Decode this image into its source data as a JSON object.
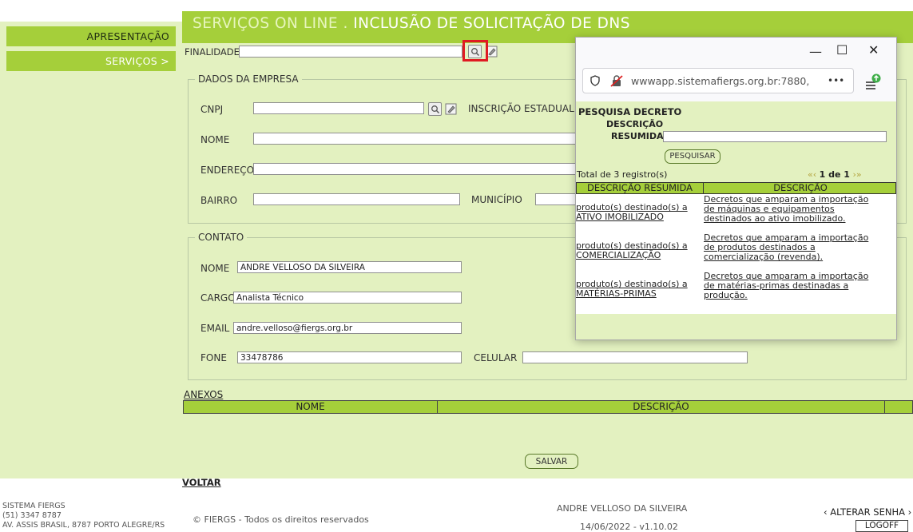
{
  "sidebar": {
    "items": [
      {
        "label": "APRESENTAÇÃO"
      },
      {
        "label": "SERVIÇOS >"
      }
    ]
  },
  "page": {
    "title_prefix": "SERVIÇOS ON LINE . ",
    "title": "INCLUSÃO DE SOLICITAÇÃO DE DNS"
  },
  "form": {
    "finalidade_label": "FINALIDADE",
    "finalidade_value": "",
    "empresa": {
      "legend": "DADOS DA EMPRESA",
      "cnpj_label": "CNPJ",
      "cnpj_value": "",
      "inscricao_label": "INSCRIÇÃO ESTADUAL",
      "nome_label": "NOME",
      "nome_value": "",
      "endereco_label": "ENDEREÇO",
      "endereco_value": "",
      "bairro_label": "BAIRRO",
      "bairro_value": "",
      "municipio_label": "MUNICÍPIO",
      "municipio_value": ""
    },
    "contato": {
      "legend": "CONTATO",
      "nome_label": "NOME",
      "nome_value": "ANDRE VELLOSO DA SILVEIRA",
      "cargo_label": "CARGO",
      "cargo_value": "Analista Técnico",
      "email_label": "EMAIL",
      "email_value": "andre.velloso@fiergs.org.br",
      "fone_label": "FONE",
      "fone_value": "33478786",
      "celular_label": "CELULAR",
      "celular_value": ""
    }
  },
  "anexos": {
    "label": "ANEXOS",
    "columns": [
      "NOME",
      "DESCRIÇÃO"
    ]
  },
  "buttons": {
    "salvar": "SALVAR",
    "voltar": "VOLTAR"
  },
  "footer": {
    "org": "SISTEMA FIERGS",
    "phone": "(51) 3347 8787",
    "address": "AV. ASSIS BRASIL, 8787 PORTO ALEGRE/RS",
    "copyright": "© FIERGS - Todos os direitos reservados",
    "user": "ANDRE VELLOSO DA SILVEIRA",
    "version": "14/06/2022 - v1.10.02",
    "alterar_senha": "‹ ALTERAR SENHA ›",
    "logoff": "LOGOFF"
  },
  "popup": {
    "url": "wwwapp.sistemafiergs.org.br:7880,",
    "url_more": "•••",
    "heading": "PESQUISA DECRETO",
    "search_label_1": "DESCRIÇÃO",
    "search_label_2": "RESUMIDA",
    "search_value": "",
    "search_button": "PESQUISAR",
    "total": "Total de 3 registro(s)",
    "pagination": "1 de 1",
    "columns": [
      "DESCRIÇÃO RESUMIDA",
      "DESCRIÇÃO"
    ],
    "rows": [
      {
        "resumida_1": "produto(s) destinado(s) a",
        "resumida_2": "ATIVO IMOBILIZADO",
        "descricao": [
          "Decretos que amparam a importação",
          "de máquinas e equipamentos",
          "destinados ao ativo imobilizado."
        ]
      },
      {
        "resumida_1": "produto(s) destinado(s) a",
        "resumida_2": "COMERCIALIZAÇÃO",
        "descricao": [
          "Decretos que amparam a importação",
          "de produtos destinados a",
          "comercialização (revenda)."
        ]
      },
      {
        "resumida_1": "produto(s) destinado(s) a",
        "resumida_2": "MATÉRIAS-PRIMAS",
        "descricao": [
          "Decretos que amparam a importação",
          "de matérias-primas destinadas a",
          "produção."
        ]
      }
    ]
  },
  "colors": {
    "accent_green": "#a5cf3a",
    "panel_green": "#e3f1c0",
    "highlight_red": "#e01a22"
  }
}
